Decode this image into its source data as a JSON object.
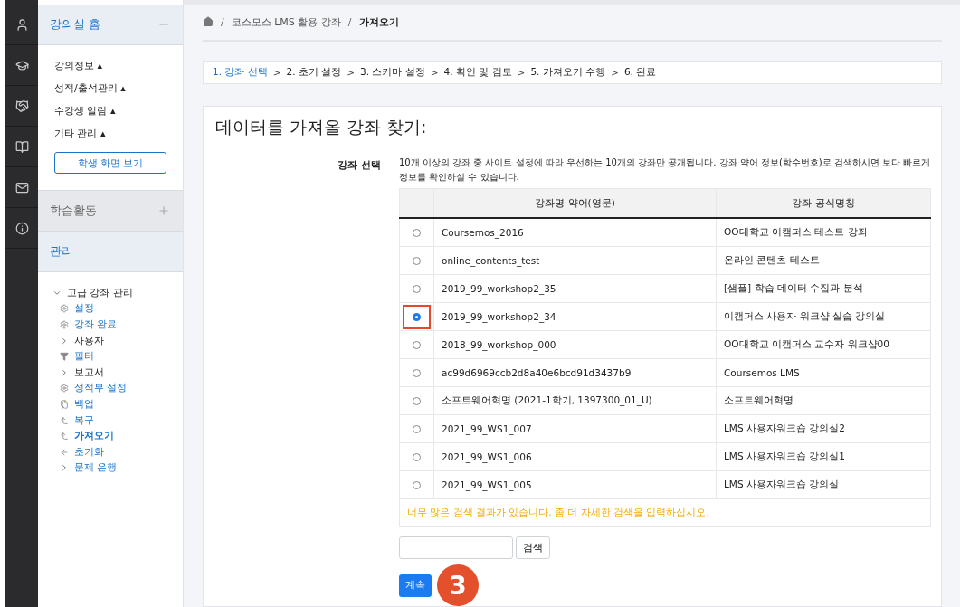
{
  "sidebar": {
    "sections": [
      {
        "title": "강의실 홈",
        "kind": "collapsible",
        "expanded": true,
        "items": [
          {
            "label": "강의정보",
            "caret": "▴"
          },
          {
            "label": "성적/출석관리",
            "caret": "▴"
          },
          {
            "label": "수강생 알림",
            "caret": "▴"
          },
          {
            "label": "기타 관리",
            "caret": "▴"
          }
        ],
        "button": "학생 화면 보기"
      },
      {
        "title": "학습활동",
        "kind": "collapsible",
        "expanded": false
      },
      {
        "title": "관리",
        "kind": "plain",
        "expanded": true,
        "tree": [
          {
            "label": "고급 강좌 관리",
            "kind": "folder",
            "expanded": true,
            "children": [
              {
                "label": "설정",
                "kind": "gear"
              },
              {
                "label": "강좌 완료",
                "kind": "gear"
              },
              {
                "label": "사용자",
                "kind": "folder",
                "expanded": false
              },
              {
                "label": "필터",
                "kind": "filter"
              },
              {
                "label": "보고서",
                "kind": "folder",
                "expanded": false
              },
              {
                "label": "성적부 설정",
                "kind": "gear"
              },
              {
                "label": "백업",
                "kind": "backup"
              },
              {
                "label": "복구",
                "kind": "restore"
              },
              {
                "label": "가져오기",
                "kind": "restore",
                "current": true
              },
              {
                "label": "초기화",
                "kind": "reset"
              },
              {
                "label": "문제 은행",
                "kind": "folder",
                "expanded": false,
                "link": true
              }
            ]
          }
        ]
      }
    ]
  },
  "breadcrumb": {
    "separator": "/",
    "items": [
      "코스모스 LMS 활용 강좌",
      "가져오기"
    ]
  },
  "steps": {
    "separator": ">",
    "items": [
      {
        "label": "1. 강좌 선택",
        "selected": true
      },
      {
        "label": "2. 초기 설정",
        "selected": false
      },
      {
        "label": "3. 스키마 설정",
        "selected": false
      },
      {
        "label": "4. 확인 및 검토",
        "selected": false
      },
      {
        "label": "5. 가져오기 수행",
        "selected": false
      },
      {
        "label": "6. 완료",
        "selected": false
      }
    ]
  },
  "heading": "데이터를 가져올 강좌 찾기:",
  "field_label": "강좌 선택",
  "description": "10개 이상의 강좌 중 사이트 설정에 따라 우선하는 10개의 강좌만 공개됩니다. 강좌 약어 정보(학수번호)로 검색하시면 보다 빠르게 정보를 확인하실 수 있습니다.",
  "table": {
    "columns": [
      "강좌명 약어(영문)",
      "강좌 공식명칭"
    ],
    "rows": [
      {
        "short": "Coursemos_2016",
        "official": "OO대학교 이캠퍼스 테스트 강좌",
        "selected": false,
        "highlighted": false
      },
      {
        "short": "online_contents_test",
        "official": "온라인 콘텐츠 테스트",
        "selected": false,
        "highlighted": false
      },
      {
        "short": "2019_99_workshop2_35",
        "official": "[샘플] 학습 데이터 수집과 분석",
        "selected": false,
        "highlighted": false
      },
      {
        "short": "2019_99_workshop2_34",
        "official": "이캠퍼스 사용자 워크샵 실습 강의실",
        "selected": true,
        "highlighted": true
      },
      {
        "short": "2018_99_workshop_000",
        "official": "OO대학교 이캠퍼스 교수자 워크샵00",
        "selected": false,
        "highlighted": false
      },
      {
        "short": "ac99d6969ccb2d8a40e6bcd91d3437b9",
        "official": "Coursemos LMS",
        "selected": false,
        "highlighted": false
      },
      {
        "short": "소프트웨어혁명 (2021-1학기, 1397300_01_U)",
        "official": "소프트웨어혁명",
        "selected": false,
        "highlighted": false
      },
      {
        "short": "2021_99_WS1_007",
        "official": "LMS 사용자워크숍 강의실2",
        "selected": false,
        "highlighted": false
      },
      {
        "short": "2021_99_WS1_006",
        "official": "LMS 사용자워크숍 강의실1",
        "selected": false,
        "highlighted": false
      },
      {
        "short": "2021_99_WS1_005",
        "official": "LMS 사용자워크숍 강의실",
        "selected": false,
        "highlighted": false
      }
    ],
    "warning": "너무 많은 검색 결과가 있습니다. 좀 더 자세한 검색을 입력하십시오."
  },
  "search_button": "검색",
  "continue_button": "계속",
  "annotation": "3"
}
